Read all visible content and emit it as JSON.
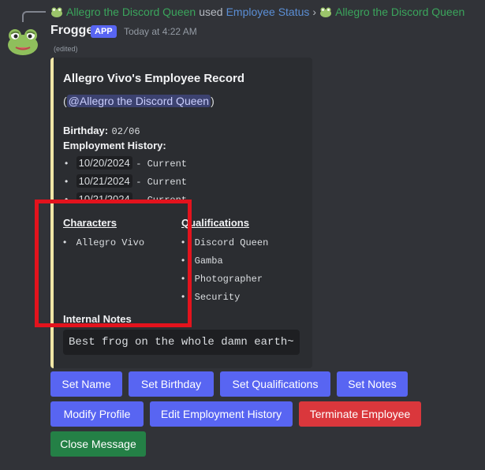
{
  "reply": {
    "invoker": "Allegro the Discord Queen",
    "used_text": "used",
    "command": "Employee Status",
    "separator": "›",
    "target": "Allegro the Discord Queen"
  },
  "message": {
    "author": "Frogge",
    "badge": "APP",
    "timestamp": "Today at 4:22 AM",
    "edited": "(edited)"
  },
  "embed": {
    "title": "Allegro Vivo's Employee Record",
    "mention_open": "(",
    "mention": "@Allegro the Discord Queen",
    "mention_close": ")",
    "birthday_label": "Birthday:",
    "birthday_value": "02/06",
    "history_label": "Employment History:",
    "history": [
      {
        "date": "10/20/2024",
        "status": "- Current"
      },
      {
        "date": "10/21/2024",
        "status": "- Current"
      },
      {
        "date": "10/21/2024",
        "status": "- Current"
      }
    ],
    "characters_label": "Characters",
    "characters": [
      "Allegro Vivo"
    ],
    "qualifications_label": "Qualifications",
    "qualifications": [
      "Discord Queen",
      "Gamba",
      "Photographer",
      "Security"
    ],
    "notes_label": "Internal Notes",
    "notes": "Best frog on the whole damn earth~",
    "accent_color": "#f0e6a6"
  },
  "buttons": {
    "set_name": "Set Name",
    "set_birthday": "Set Birthday",
    "set_qualifications": "Set Qualifications",
    "set_notes": "Set Notes",
    "modify_profile": "Modify Profile",
    "edit_history": "Edit Employment History",
    "terminate": "Terminate Employee",
    "close": "Close Message"
  },
  "icons": {
    "avatar": "frog-avatar-icon",
    "reply_mini_avatar": "frog-mini-icon"
  },
  "colors": {
    "background": "#313338",
    "blurple": "#5865f2",
    "danger": "#da373c",
    "success": "#248046",
    "highlight_box": "#e3131d"
  }
}
